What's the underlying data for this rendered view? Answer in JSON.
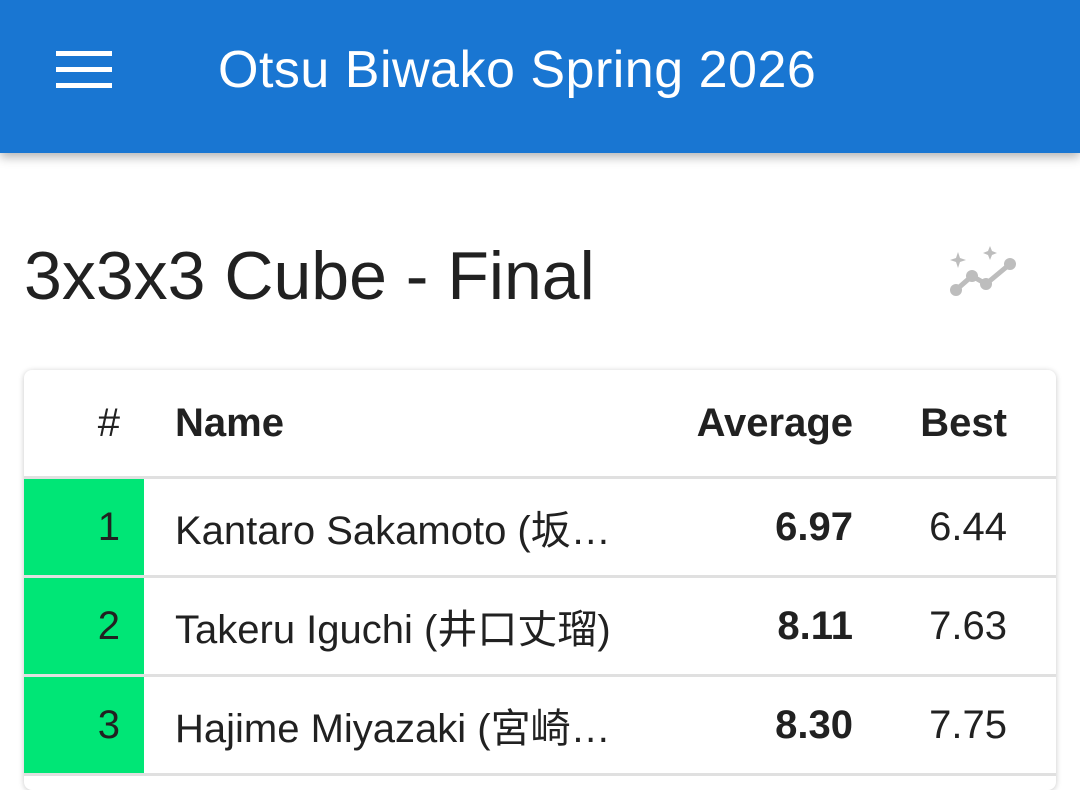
{
  "appbar": {
    "title": "Otsu Biwako Spring 2026",
    "menu_icon": "menu-icon"
  },
  "page": {
    "title": "3x3x3 Cube - Final",
    "chart_icon": "auto-graph-icon"
  },
  "table": {
    "headers": {
      "rank": "#",
      "name": "Name",
      "average": "Average",
      "best": "Best"
    },
    "rows": [
      {
        "rank": "1",
        "name": "Kantaro Sakamoto (坂…",
        "average": "6.97",
        "best": "6.44"
      },
      {
        "rank": "2",
        "name": "Takeru Iguchi (井口丈瑠)",
        "average": "8.11",
        "best": "7.63"
      },
      {
        "rank": "3",
        "name": "Hajime Miyazaki (宮崎…",
        "average": "8.30",
        "best": "7.75"
      }
    ],
    "advancing_color": "#00e676"
  },
  "colors": {
    "appbar": "#1976d2",
    "text": "#212121"
  }
}
